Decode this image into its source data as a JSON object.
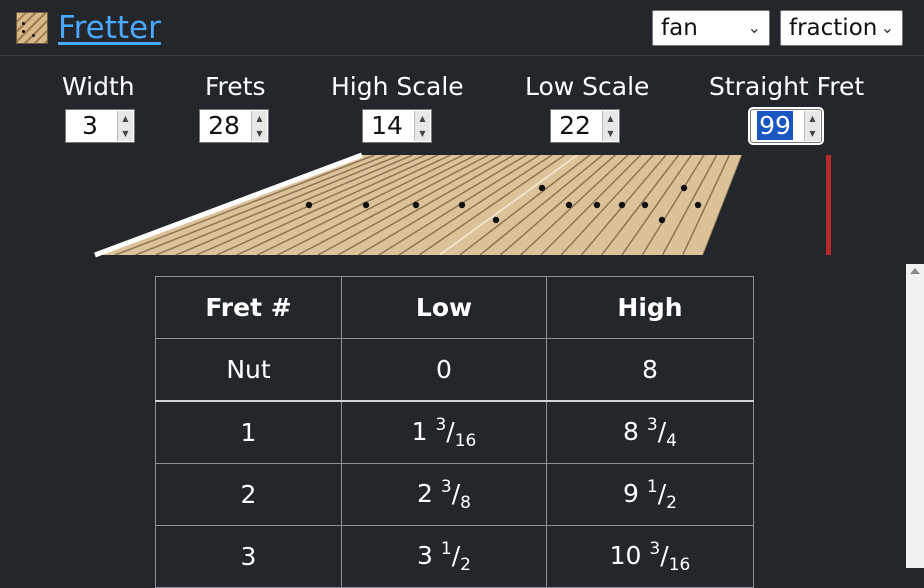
{
  "app": {
    "title": "Fretter"
  },
  "toolbar": {
    "layout_select": "fan",
    "format_select": "fraction"
  },
  "controls": [
    {
      "label": "Width",
      "value": "3"
    },
    {
      "label": "Frets",
      "value": "28"
    },
    {
      "label": "High Scale",
      "value": "14"
    },
    {
      "label": "Low Scale",
      "value": "22"
    },
    {
      "label": "Straight Fret",
      "value": "99"
    }
  ],
  "table": {
    "headers": [
      "Fret #",
      "Low",
      "High"
    ],
    "rows": [
      {
        "fret": "Nut",
        "low": {
          "whole": "0"
        },
        "high": {
          "whole": "8"
        }
      },
      {
        "fret": "1",
        "low": {
          "whole": "1",
          "num": "3",
          "den": "16"
        },
        "high": {
          "whole": "8",
          "num": "3",
          "den": "4"
        }
      },
      {
        "fret": "2",
        "low": {
          "whole": "2",
          "num": "3",
          "den": "8"
        },
        "high": {
          "whole": "9",
          "num": "1",
          "den": "2"
        }
      },
      {
        "fret": "3",
        "low": {
          "whole": "3",
          "num": "1",
          "den": "2"
        },
        "high": {
          "whole": "10",
          "num": "3",
          "den": "16"
        }
      }
    ]
  },
  "colors": {
    "background": "#23262b",
    "link": "#4aa8ff",
    "wood_light": "#dcc298",
    "wood_fret": "#8c7656",
    "marker": "#111111",
    "straight_fret_indicator": "#b8292c"
  }
}
